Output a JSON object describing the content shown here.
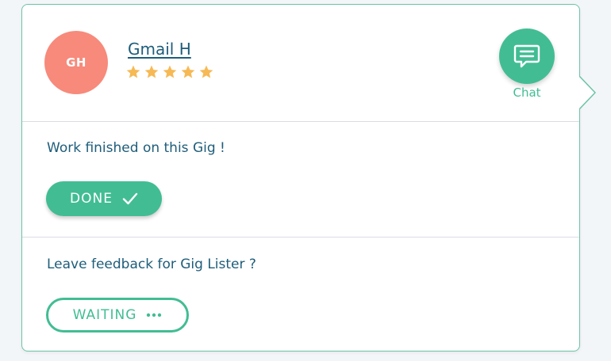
{
  "user": {
    "initials": "GH",
    "name": "Gmail H",
    "rating": 5,
    "rating_max": 5
  },
  "chat": {
    "label": "Chat",
    "icon": "chat-bubble-icon"
  },
  "work_status": {
    "text": "Work finished on this Gig !",
    "button_label": "DONE",
    "button_icon": "checkmark-icon"
  },
  "feedback_status": {
    "text": "Leave feedback for Gig Lister ?",
    "button_label": "WAITING",
    "button_icon": "ellipsis-icon"
  },
  "colors": {
    "accent": "#42bd93",
    "avatar": "#f78a7b",
    "text": "#1e5d7a",
    "star": "#f6b955"
  }
}
